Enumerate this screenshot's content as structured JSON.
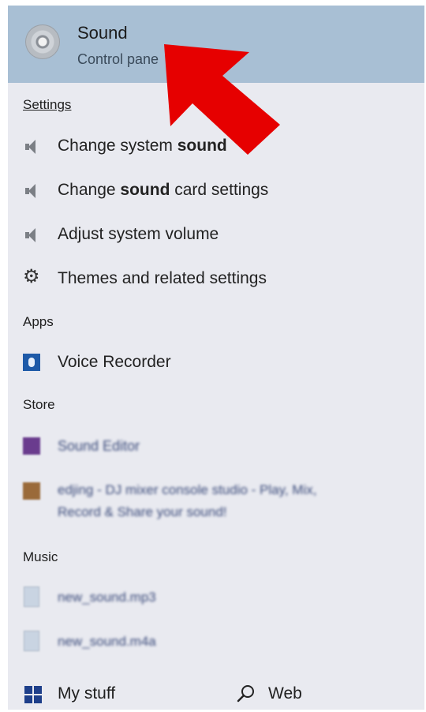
{
  "top_result": {
    "title": "Sound",
    "subtitle": "Control pane"
  },
  "sections": {
    "settings": "Settings",
    "apps": "Apps",
    "store": "Store",
    "music": "Music"
  },
  "settings_items": [
    {
      "pre": "Change system ",
      "bold": "sound",
      "post": ""
    },
    {
      "pre": "Change ",
      "bold": "sound",
      "post": " card settings"
    },
    {
      "pre": "Adjust system volume",
      "bold": "",
      "post": ""
    },
    {
      "pre": "Themes and related settings",
      "bold": "",
      "post": ""
    }
  ],
  "apps_items": [
    {
      "label": "Voice Recorder"
    }
  ],
  "store_items": [
    {
      "label": "Sound Editor"
    },
    {
      "line1": "edjing - DJ mixer console studio - Play, Mix,",
      "line2": "Record & Share your sound!"
    }
  ],
  "music_items": [
    {
      "label": "new_sound.mp3"
    },
    {
      "label": "new_sound.m4a"
    }
  ],
  "bottom": {
    "my_stuff": "My stuff",
    "web": "Web"
  },
  "colors": {
    "highlight": "#a8bfd4",
    "panel": "#e9eaf0",
    "arrow": "#e60000"
  },
  "icons": {
    "top_result": "speaker-disc-icon",
    "settings": [
      "speaker-icon",
      "speaker-icon",
      "speaker-icon",
      "gear-icon"
    ],
    "apps": [
      "voice-recorder-icon"
    ],
    "bottom": [
      "windows-icon",
      "search-icon"
    ]
  }
}
